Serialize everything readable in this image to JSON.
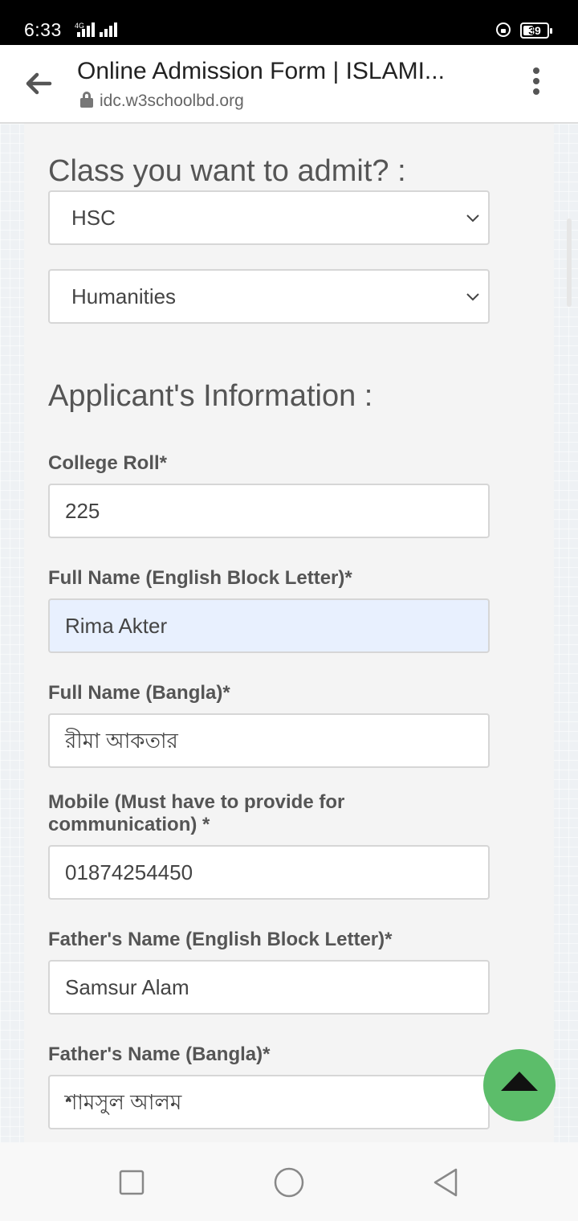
{
  "status_bar": {
    "time": "6:33",
    "network": "4G",
    "battery": "39",
    "icons": [
      "signal-icon",
      "rotation-lock-icon",
      "battery-icon"
    ]
  },
  "browser": {
    "title": "Online Admission Form | ISLAMI...",
    "url": "idc.w3schoolbd.org",
    "icons": [
      "back-arrow-icon",
      "lock-icon",
      "more-vert-icon"
    ]
  },
  "form": {
    "class_heading": "Class you want to admit? :",
    "class_select": "HSC",
    "group_select": "Humanities",
    "applicant_heading": "Applicant's Information :",
    "fields": [
      {
        "label": "College Roll*",
        "value": "225"
      },
      {
        "label": "Full Name (English Block Letter)*",
        "value": "Rima Akter"
      },
      {
        "label": "Full Name (Bangla)*",
        "value": "রীমা আকতার"
      },
      {
        "label": "Mobile (Must have to provide for communication) *",
        "value": "01874254450"
      },
      {
        "label": "Father's Name (English Block Letter)*",
        "value": "Samsur Alam"
      },
      {
        "label": "Father's Name (Bangla)*",
        "value": "শামসুল আলম"
      }
    ]
  },
  "fab": {
    "icon": "arrow-up-icon",
    "color": "#5cbd6a"
  },
  "nav_bar": {
    "icons": [
      "recent-apps-icon",
      "home-icon",
      "back-icon"
    ]
  }
}
